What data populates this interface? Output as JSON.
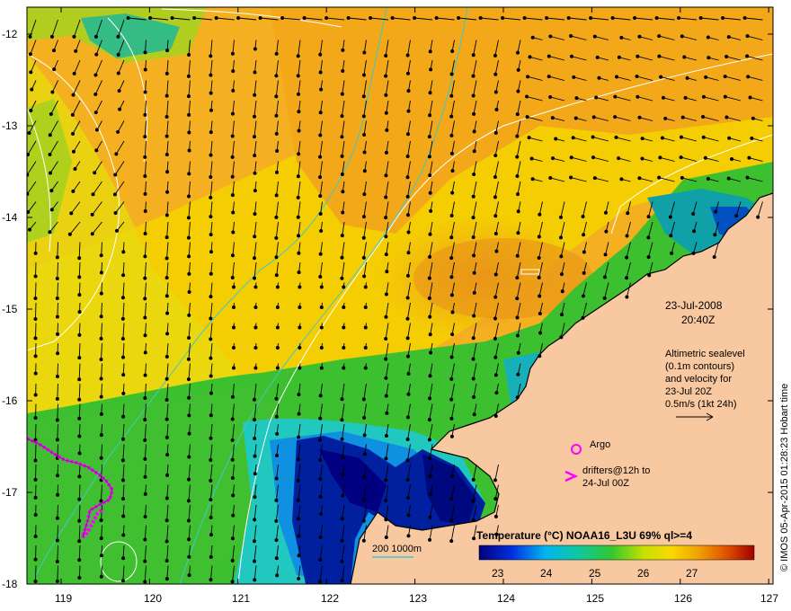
{
  "map": {
    "lat_ticks": [
      "-12",
      "-13",
      "-14",
      "-15",
      "-16",
      "-17",
      "-18"
    ],
    "lon_ticks": [
      "119",
      "120",
      "121",
      "122",
      "123",
      "124",
      "125",
      "126",
      "127"
    ]
  },
  "date_label": {
    "date": "23-Jul-2008",
    "time": "20:40Z"
  },
  "altimetry_note": {
    "lines": [
      "Altimetric sealevel",
      "(0.1m contours)",
      "and velocity for",
      "23-Jul 20Z",
      "0.5m/s (1kt 24h)"
    ]
  },
  "legend": {
    "argo_label": "Argo",
    "drifters_line1": "drifters@12h to",
    "drifters_line2": "24-Jul 00Z",
    "argo_color": "#ff00ff",
    "drifter_color": "#ff00ff"
  },
  "bathymetry_label": "200  1000m",
  "bathymetry_color": "#40c8c8",
  "colorbar": {
    "title": "Temperature (°C) NOAA16_L3U 69% ql>=4",
    "ticks": [
      "23",
      "24",
      "25",
      "26",
      "27"
    ],
    "range": [
      22.3,
      28.0
    ]
  },
  "credit": "© IMOS 05-Apr-2015 01:28:23 Hobart time",
  "colors": {
    "land": "#f8c8a0",
    "warm": "#f0a820",
    "cool": "#10a010",
    "coldest": "#000080"
  }
}
